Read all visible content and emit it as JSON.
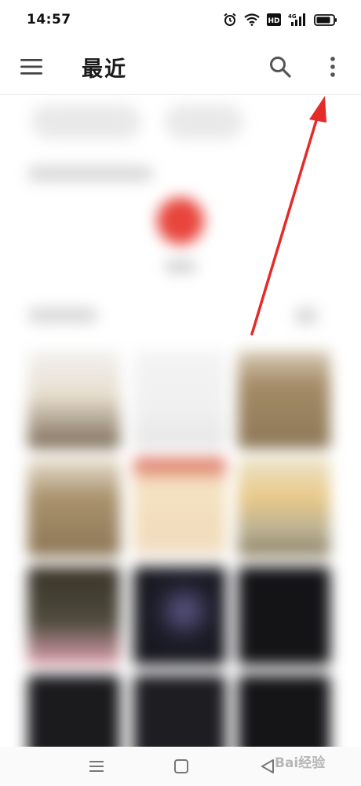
{
  "status_bar": {
    "time": "14:57",
    "icons": [
      "alarm-icon",
      "wifi-icon",
      "hd-icon",
      "signal-4g-icon",
      "battery-icon"
    ],
    "hd_label": "HD",
    "network_label": "4G"
  },
  "app_bar": {
    "title": "最近",
    "icons": [
      "menu-icon",
      "search-icon",
      "more-vert-icon"
    ]
  },
  "nav_bar": {
    "icons": [
      "recents-menu-icon",
      "home-square-icon",
      "back-triangle-icon"
    ]
  },
  "annotation": {
    "arrow_color": "#e52a2a"
  },
  "watermark": {
    "text": "Bai经验"
  },
  "colors": {
    "accent_red": "#e8453c",
    "background": "#ffffff"
  }
}
